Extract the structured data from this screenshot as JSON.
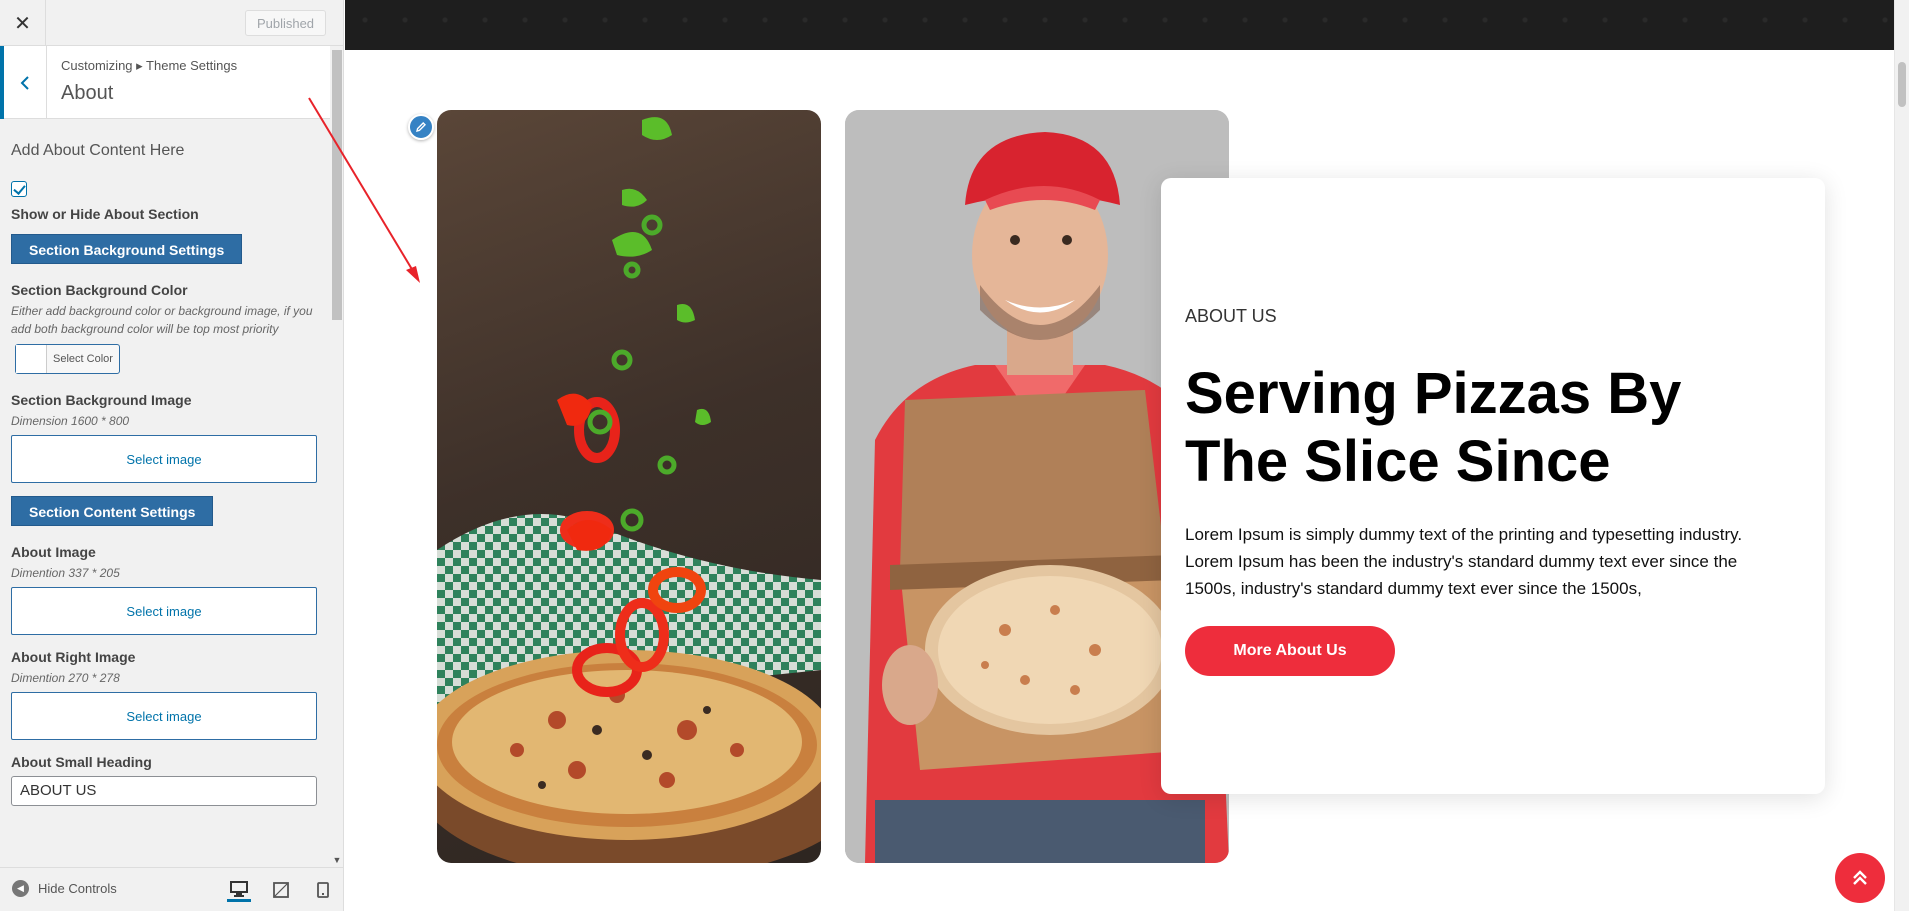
{
  "customizer": {
    "close_icon": "close-icon",
    "publish_label": "Published",
    "breadcrumb": "Customizing ▸ Theme Settings",
    "section_title": "About",
    "description": "Add About Content Here",
    "show_hide_checked": true,
    "show_hide_label": "Show or Hide About Section",
    "bg_settings_button": "Section Background Settings",
    "bg_color_label": "Section Background Color",
    "bg_color_note": "Either add background color or background image, if you add both background color will be top most priority",
    "select_color_label": "Select Color",
    "bg_image_label": "Section Background Image",
    "bg_image_note": "Dimension 1600 * 800",
    "select_image_label": "Select image",
    "content_settings_button": "Section Content Settings",
    "about_image_label": "About Image",
    "about_image_note": "Dimention 337 * 205",
    "about_right_image_label": "About Right Image",
    "about_right_image_note": "Dimention 270 * 278",
    "small_heading_label": "About Small Heading",
    "small_heading_value": "ABOUT US",
    "hide_controls_label": "Hide Controls",
    "accent_color": "#0073aa"
  },
  "preview": {
    "about_small": "ABOUT US",
    "about_heading": "Serving Pizzas By The Slice Since",
    "about_text": "Lorem Ipsum is simply dummy text of the printing and typesetting industry. Lorem Ipsum has been the industry's standard dummy text ever since the 1500s, industry's standard dummy text ever since the 1500s,",
    "about_button": "More About Us",
    "brand_color": "#ee2d3c",
    "pizza_image_alt": "pizza-with-falling-peppers-image",
    "delivery_image_alt": "delivery-man-with-pizza-box-image"
  }
}
